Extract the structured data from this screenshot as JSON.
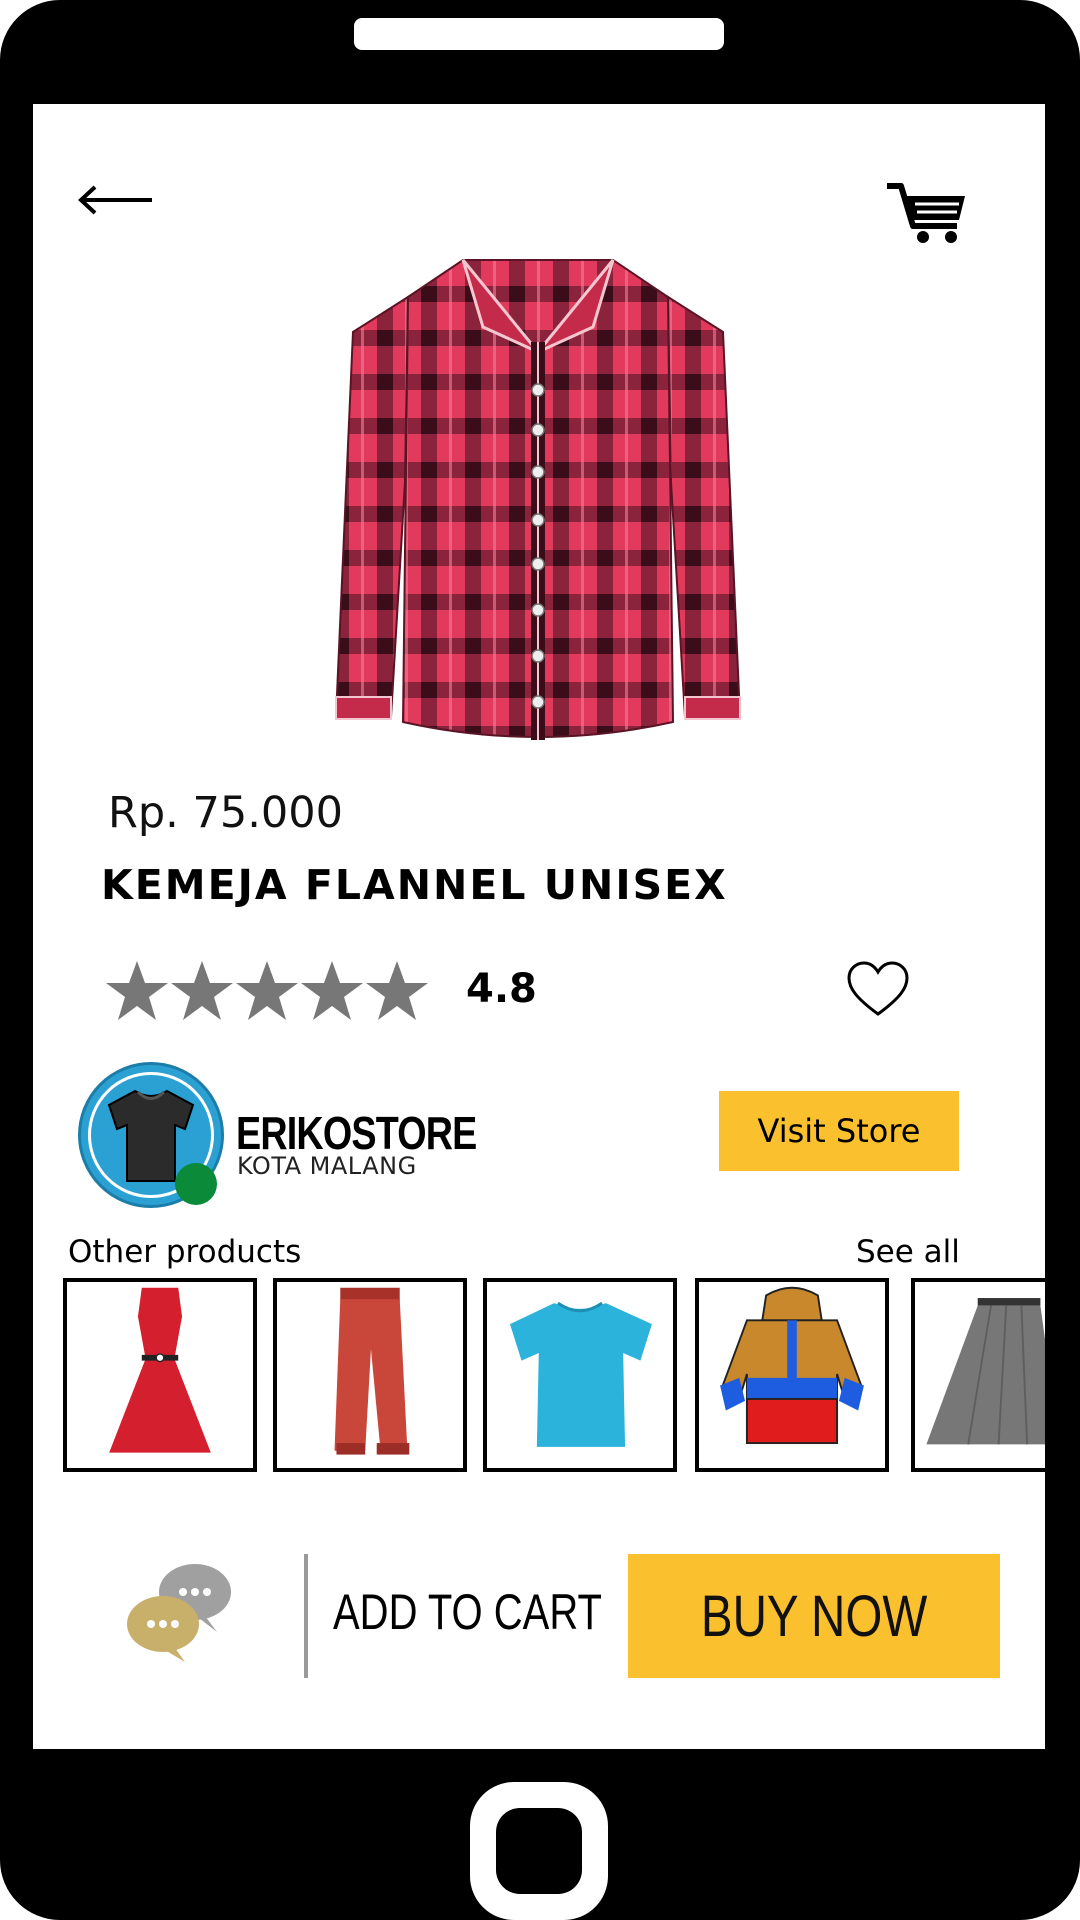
{
  "header": {
    "back_icon": "arrow-left-icon",
    "cart_icon": "shopping-cart-icon"
  },
  "product": {
    "image": "red-plaid-flannel-shirt",
    "price": "Rp. 75.000",
    "name": "KEMEJA FLANNEL UNISEX",
    "rating": "4.8",
    "stars": 5,
    "star_color": "#777777",
    "favorite_icon": "heart-outline-icon"
  },
  "store": {
    "name": "ERIKOSTORE",
    "city": "KOTA MALANG",
    "avatar_icon": "tshirt-icon",
    "online_status_color": "#0b8a3a",
    "visit_label": "Visit Store"
  },
  "other_products": {
    "title": "Other products",
    "see_all": "See all",
    "items": [
      {
        "icon": "red-dress"
      },
      {
        "icon": "red-trousers"
      },
      {
        "icon": "blue-tshirt"
      },
      {
        "icon": "hoodie-jacket"
      },
      {
        "icon": "gray-skirt"
      }
    ]
  },
  "bottom_bar": {
    "chat_icon": "chat-bubbles-icon",
    "add_to_cart": "ADD TO CART",
    "buy_now": "BUY NOW"
  },
  "colors": {
    "accent": "#fbc02d",
    "frame": "#000000",
    "background": "#ffffff"
  }
}
